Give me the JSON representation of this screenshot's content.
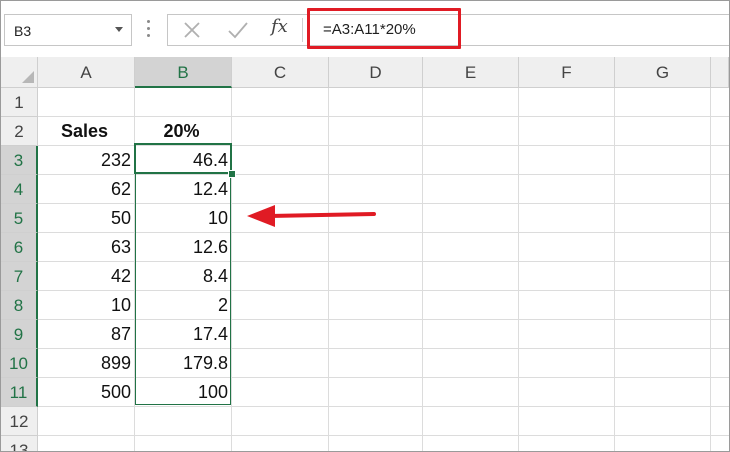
{
  "name_box": {
    "value": "B3"
  },
  "formula_bar": {
    "fx_label": "fx",
    "formula": "=A3:A11*20%"
  },
  "columns": [
    "A",
    "B",
    "C",
    "D",
    "E",
    "F",
    "G"
  ],
  "rows": [
    "1",
    "2",
    "3",
    "4",
    "5",
    "6",
    "7",
    "8",
    "9",
    "10",
    "11",
    "12",
    "13"
  ],
  "cells": {
    "a2": "Sales",
    "b2": "20%",
    "a3": "232",
    "b3": "46.4",
    "a4": "62",
    "b4": "12.4",
    "a5": "50",
    "b5": "10",
    "a6": "63",
    "b6": "12.6",
    "a7": "42",
    "b7": "8.4",
    "a8": "10",
    "b8": "2",
    "a9": "87",
    "b9": "17.4",
    "a10": "899",
    "b10": "179.8",
    "a11": "500",
    "b11": "100"
  },
  "selection": {
    "active_cell": "B3",
    "range": "B3:B11"
  },
  "colors": {
    "selection_green": "#217346",
    "annotation_red": "#e01b24"
  }
}
